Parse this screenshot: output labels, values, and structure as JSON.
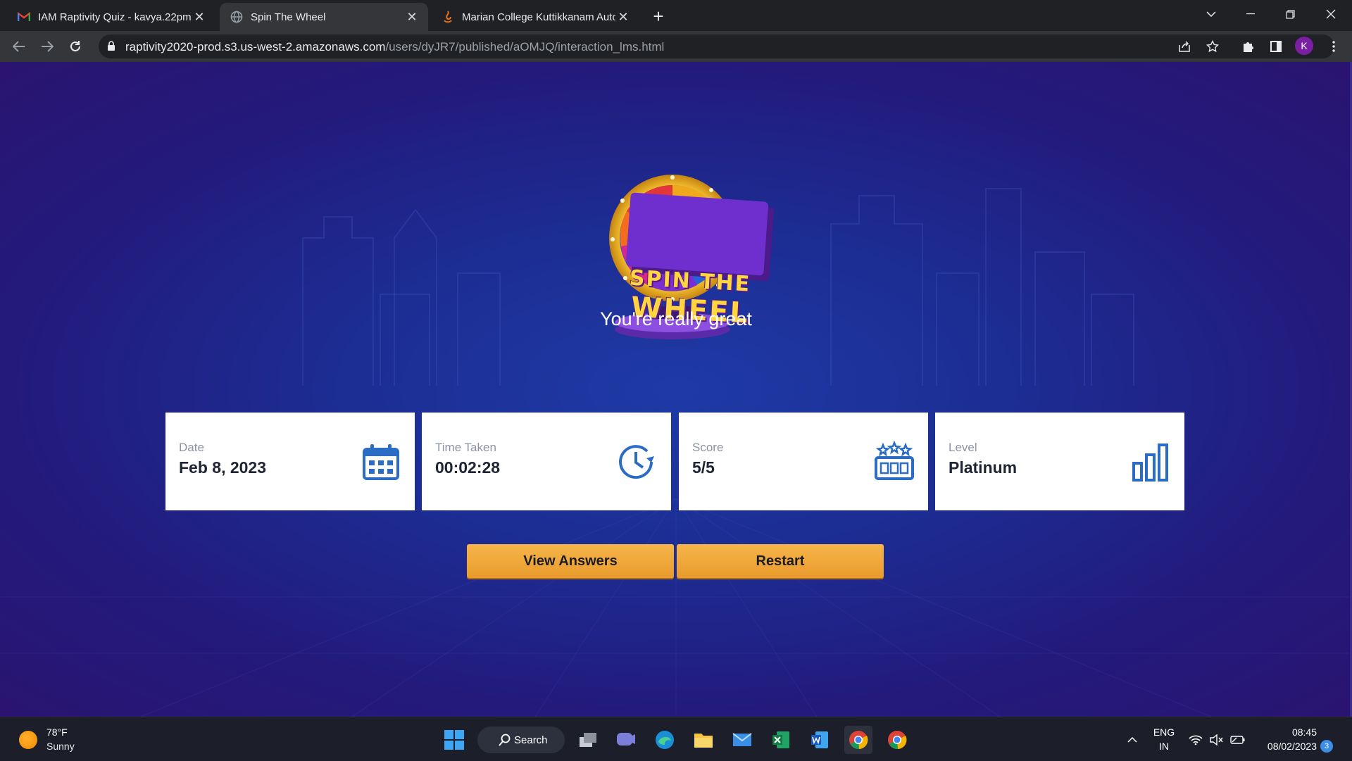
{
  "browser": {
    "tabs": [
      {
        "title": "IAM Raptivity Quiz - kavya.22pm",
        "icon": "gmail-icon"
      },
      {
        "title": "Spin The Wheel",
        "icon": "globe-icon"
      },
      {
        "title": "Marian College Kuttikkanam Auto",
        "icon": "site-icon"
      }
    ],
    "url_host": "raptivity2020-prod.s3.us-west-2.amazonaws.com",
    "url_path": "/users/dyJR7/published/aOMJQ/interaction_lms.html",
    "profile_initial": "K"
  },
  "page": {
    "logo_line1": "SPIN THE",
    "logo_line2": "WHEEL",
    "headline": "You're really great",
    "cards": [
      {
        "label": "Date",
        "value": "Feb 8, 2023",
        "icon": "calendar-icon"
      },
      {
        "label": "Time Taken",
        "value": "00:02:28",
        "icon": "clock-icon"
      },
      {
        "label": "Score",
        "value": "5/5",
        "icon": "score-stars-icon"
      },
      {
        "label": "Level",
        "value": "Platinum",
        "icon": "bar-chart-icon"
      }
    ],
    "buttons": {
      "view_answers": "View Answers",
      "restart": "Restart"
    },
    "colors": {
      "accent_button": "#f0a83a",
      "card_icon": "#2b6cc4",
      "page_bg": "#1f2e99"
    }
  },
  "taskbar": {
    "weather_temp": "78°F",
    "weather_condition": "Sunny",
    "search_label": "Search",
    "lang_line1": "ENG",
    "lang_line2": "IN",
    "time": "08:45",
    "date": "08/02/2023",
    "notification_count": "3"
  }
}
